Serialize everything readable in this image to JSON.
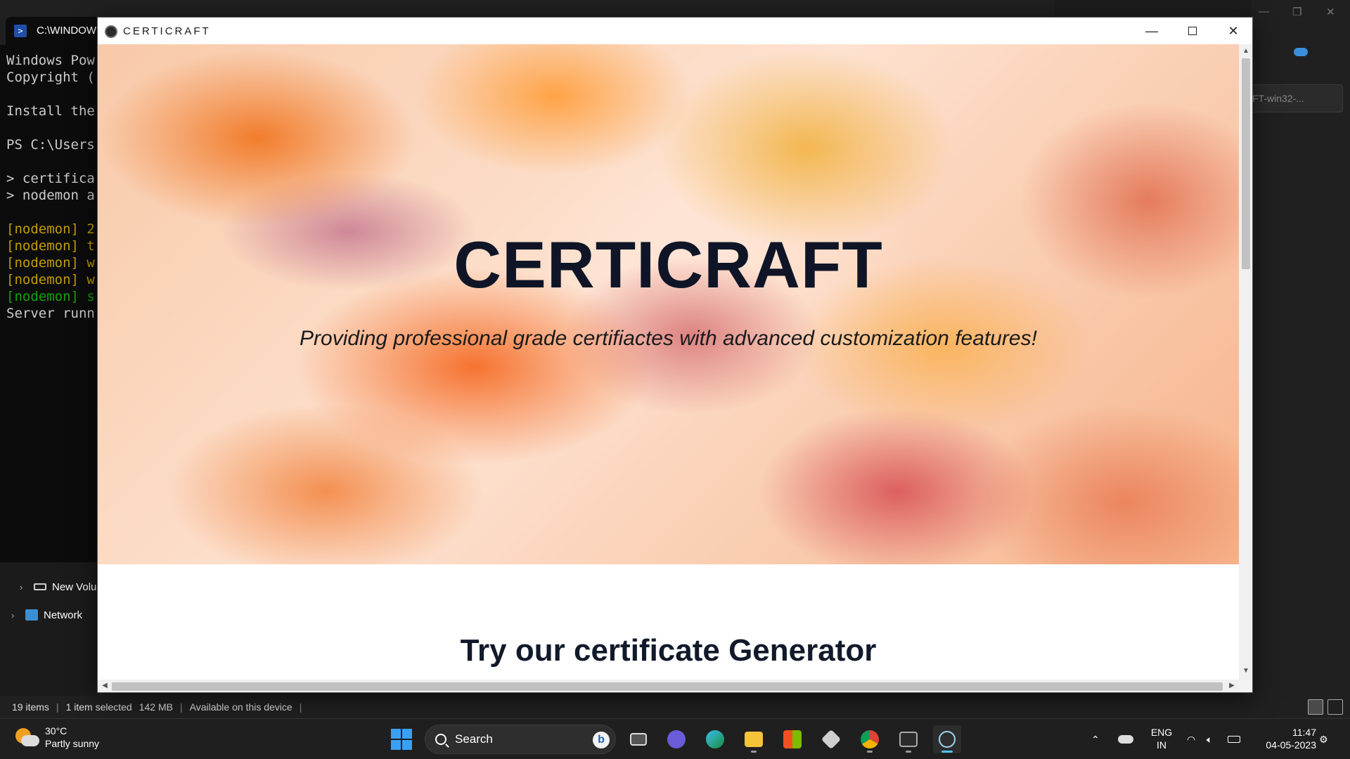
{
  "terminal": {
    "tab_title": "C:\\WINDOW",
    "lines": [
      {
        "text": "Windows Pow",
        "color": "default"
      },
      {
        "text": "Copyright (",
        "color": "default"
      },
      {
        "text": "",
        "color": "default"
      },
      {
        "text": "Install the",
        "color": "default"
      },
      {
        "text": "",
        "color": "default"
      },
      {
        "text": "PS C:\\Users",
        "color": "default"
      },
      {
        "text": "",
        "color": "default"
      },
      {
        "text": "> certifica",
        "color": "default"
      },
      {
        "text": "> nodemon a",
        "color": "default"
      },
      {
        "text": "",
        "color": "default"
      },
      {
        "text": "[nodemon] 2",
        "color": "yellow"
      },
      {
        "text": "[nodemon] t",
        "color": "yellow"
      },
      {
        "text": "[nodemon] w",
        "color": "yellow"
      },
      {
        "text": "[nodemon] w",
        "color": "yellow"
      },
      {
        "text": "[nodemon] s",
        "color": "green"
      },
      {
        "text": "Server runn",
        "color": "default"
      }
    ]
  },
  "explorer": {
    "nav_items": [
      {
        "label": "New Volu",
        "icon": "drive-icon"
      },
      {
        "label": "Network",
        "icon": "network-icon"
      }
    ],
    "search_placeholder": "FT-win32-...",
    "status": {
      "items_count": "19 items",
      "selected": "1 item selected",
      "size": "142 MB",
      "availability": "Available on this device"
    }
  },
  "app": {
    "window_title": "CERTICRAFT",
    "hero_title": "CERTICRAFT",
    "hero_subtitle": "Providing professional grade certifiactes with advanced customization features!",
    "section_title": "Try our certificate Generator",
    "accent_color": "#0f1526"
  },
  "taskbar": {
    "weather": {
      "temp": "30°C",
      "condition": "Partly sunny"
    },
    "search_label": "Search",
    "apps": [
      {
        "name": "task-view",
        "icon": "task-view-icon"
      },
      {
        "name": "teams",
        "icon": "teams-icon"
      },
      {
        "name": "edge",
        "icon": "edge-icon"
      },
      {
        "name": "file-explorer",
        "icon": "folder-icon"
      },
      {
        "name": "store",
        "icon": "store-icon"
      },
      {
        "name": "unity",
        "icon": "unity-icon"
      },
      {
        "name": "chrome",
        "icon": "chrome-icon"
      },
      {
        "name": "terminal",
        "icon": "terminal-icon"
      },
      {
        "name": "electron",
        "icon": "electron-icon"
      }
    ],
    "language": {
      "line1": "ENG",
      "line2": "IN"
    },
    "clock": {
      "time": "11:47",
      "date": "04-05-2023"
    }
  }
}
